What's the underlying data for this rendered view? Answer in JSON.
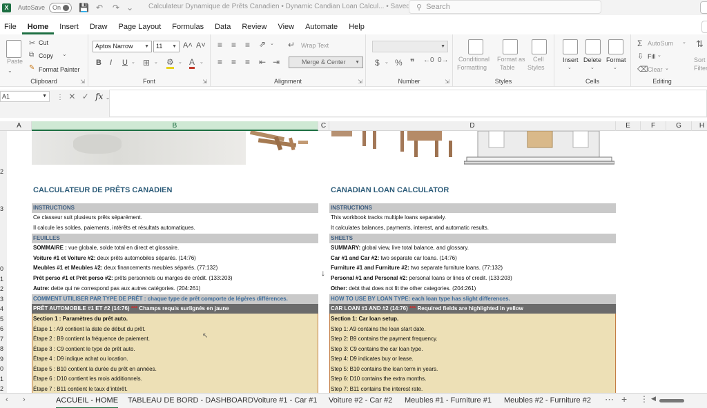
{
  "titlebar": {
    "autosave": "AutoSave",
    "toggle": "On",
    "doc_title": "Calculateur Dynamique de Prêts Canadien • Dynamic Candian Loan Calcul...  •  Saved",
    "search_placeholder": "Search"
  },
  "menu": {
    "tabs": [
      "File",
      "Home",
      "Insert",
      "Draw",
      "Page Layout",
      "Formulas",
      "Data",
      "Review",
      "View",
      "Automate",
      "Help"
    ],
    "active": "Home"
  },
  "ribbon": {
    "clipboard": {
      "paste": "Paste",
      "cut": "Cut",
      "copy": "Copy",
      "format_painter": "Format Painter",
      "label": "Clipboard"
    },
    "font": {
      "name": "Aptos Narrow",
      "size": "11",
      "grow": "A˄",
      "shrink": "A˅",
      "bold": "B",
      "italic": "I",
      "underline": "U",
      "label": "Font"
    },
    "alignment": {
      "wrap": "Wrap Text",
      "merge": "Merge & Center",
      "label": "Alignment"
    },
    "number": {
      "format": "",
      "currency": "$",
      "percent": "%",
      "label": "Number"
    },
    "styles": {
      "conditional": "Conditional",
      "conditional2": "Formatting",
      "format_table": "Format as",
      "format_table2": "Table",
      "cell_styles": "Cell",
      "cell_styles2": "Styles",
      "label": "Styles"
    },
    "cells": {
      "insert": "Insert",
      "delete": "Delete",
      "format": "Format",
      "label": "Cells"
    },
    "editing": {
      "autosum": "AutoSum",
      "fill": "Fill",
      "clear": "Clear",
      "sort": "Sort",
      "filter": "Filter",
      "label": "Editing"
    }
  },
  "formula": {
    "namebox": "A1",
    "fx": "fx",
    "value": ""
  },
  "columns": [
    "A",
    "B",
    "C",
    "D",
    "E",
    "F",
    "G",
    "H"
  ],
  "selected_column": "B",
  "rows": [
    "",
    "",
    "2",
    "",
    "",
    "3",
    "",
    "",
    "",
    "",
    "0",
    "1",
    "2",
    "3",
    "4",
    "5",
    "6",
    "7",
    "8",
    "9",
    "0",
    "1",
    "2"
  ],
  "content": {
    "fr": {
      "title": "CALCULATEUR DE PRÊTS CANADIEN",
      "instructions_hdr": "INSTRUCTIONS",
      "instr1": "Ce classeur suit plusieurs prêts séparément.",
      "instr2": "Il calcule les soldes, paiements, intérêts et résultats automatiques.",
      "feuilles_hdr": "FEUILLES",
      "sheet1_b": "SOMMAIRE :",
      "sheet1": " vue globale, solde total en direct et glossaire.",
      "sheet2_b": "Voiture #1 et Voiture #2:",
      "sheet2": " deux prêts automobiles séparés. (14:76)",
      "sheet3_b": "Meubles #1 et Meubles #2:",
      "sheet3": " deux financements meubles séparés. (77:132)",
      "sheet4_b": "Prêt perso #1 et Prêt perso #2:",
      "sheet4": " prêts personnels ou marges de crédit. (133:203)",
      "sheet5_b": "Autre:",
      "sheet5": " dette qui ne correspond pas aux autres catégories. (204:261)",
      "howto": "COMMENT UTILISER PAR TYPE DE PRÊT : chaque type de prêt comporte de légères différences.",
      "auto_hdr": "PRÊT AUTOMOBILE #1 ET #2 (14:76)",
      "auto_req_stars": " *** ",
      "auto_req": "Champs requis surlignés en jaune",
      "section1": "Section 1 : Paramètres du prêt auto.",
      "steps": [
        "Étape 1 : A9 contient la date de début du prêt.",
        "Étape 2 : B9 contient la fréquence de paiement.",
        "Étape 3 : C9 contient le type de prêt auto.",
        "Étape 4 : D9 indique achat ou location.",
        "Étape 5 : B10 contient la durée du prêt en années.",
        "Étape 6 : D10 contient les mois additionnels.",
        "Étape 7 : B11 contient le taux d’intérêt."
      ]
    },
    "en": {
      "title": "CANADIAN LOAN CALCULATOR",
      "instructions_hdr": "INSTRUCTIONS",
      "instr1": "This workbook tracks multiple loans separately.",
      "instr2": "It calculates balances, payments, interest, and automatic results.",
      "sheets_hdr": "SHEETS",
      "sheet1_b": "SUMMARY:",
      "sheet1": " global view, live total balance, and glossary.",
      "sheet2_b": "Car #1 and Car #2:",
      "sheet2": " two separate car loans. (14:76)",
      "sheet3_b": "Furniture #1 and Furniture #2:",
      "sheet3": " two separate furniture loans. (77:132)",
      "sheet4_b": "Personal #1 and Personal #2:",
      "sheet4": " personal loans or lines of credit. (133:203)",
      "sheet5_b": "Other:",
      "sheet5": " debt that does not fit the other categories. (204:261)",
      "howto": "HOW TO USE BY LOAN TYPE: each loan type has slight differences.",
      "auto_hdr": "CAR LOAN #1 AND #2 (14:76)",
      "auto_req_stars": " *** ",
      "auto_req": "Required fields are highlighted in yellow",
      "section1": "Section 1: Car loan setup.",
      "steps": [
        "Step 1: A9 contains the loan start date.",
        "Step 2: B9 contains the payment frequency.",
        "Step 3: C9 contains the car loan type.",
        "Step 4: D9 indicates buy or lease.",
        "Step 5: B10 contains the loan term in years.",
        "Step 6: D10 contains the extra months.",
        "Step 7: B11 contains the interest rate."
      ]
    }
  },
  "sheet_tabs": [
    "ACCUEIL - HOME",
    "TABLEAU DE BORD - DASHBOARD",
    "Voiture #1 - Car #1",
    "Voiture #2 - Car #2",
    "Meubles #1 - Furniture #1",
    "Meubles #2 - Furniture #2"
  ],
  "active_sheet": "ACCUEIL - HOME",
  "colors": {
    "excel_green": "#1d6f42",
    "title_blue": "#2e5d7a",
    "header_gray": "#c9c9c9",
    "dark_band": "#6b6b6b",
    "yellow_fill": "#ede0b6",
    "required_red": "#d12b2b"
  }
}
